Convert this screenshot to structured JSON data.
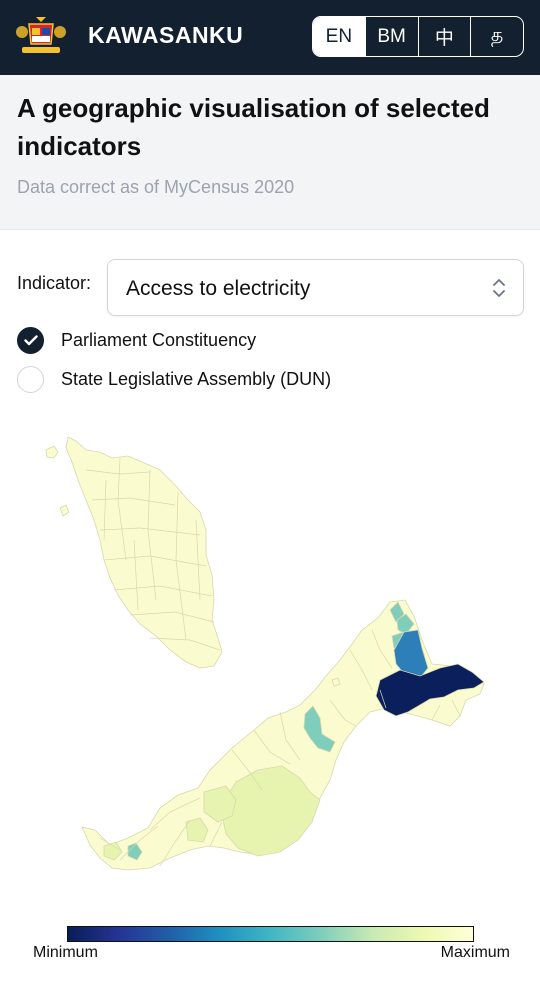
{
  "header": {
    "brand": "KAWASANKU",
    "languages": [
      "EN",
      "BM",
      "中",
      "த"
    ],
    "active_language": "EN"
  },
  "hero": {
    "title": "A geographic visualisation of selected indicators",
    "subtitle": "Data correct as of MyCensus 2020"
  },
  "controls": {
    "indicator_label": "Indicator:",
    "indicator_value": "Access to electricity",
    "options": [
      {
        "label": "Parliament Constituency",
        "selected": true
      },
      {
        "label": "State Legislative Assembly (DUN)",
        "selected": false
      }
    ]
  },
  "map": {
    "colors": {
      "base": "#fbfbd0",
      "border": "#d8d8ae",
      "light_green": "#e6f4b0",
      "teal": "#7fcdbb",
      "blue": "#2c7fb8",
      "navy": "#0b1f5c"
    },
    "legend": {
      "min_label": "Minimum",
      "max_label": "Maximum",
      "gradient": [
        "#081d58",
        "#253494",
        "#225ea8",
        "#1d91c0",
        "#41b6c4",
        "#7fcdbb",
        "#c7e9b4",
        "#edf8b1",
        "#ffffd9"
      ]
    }
  }
}
